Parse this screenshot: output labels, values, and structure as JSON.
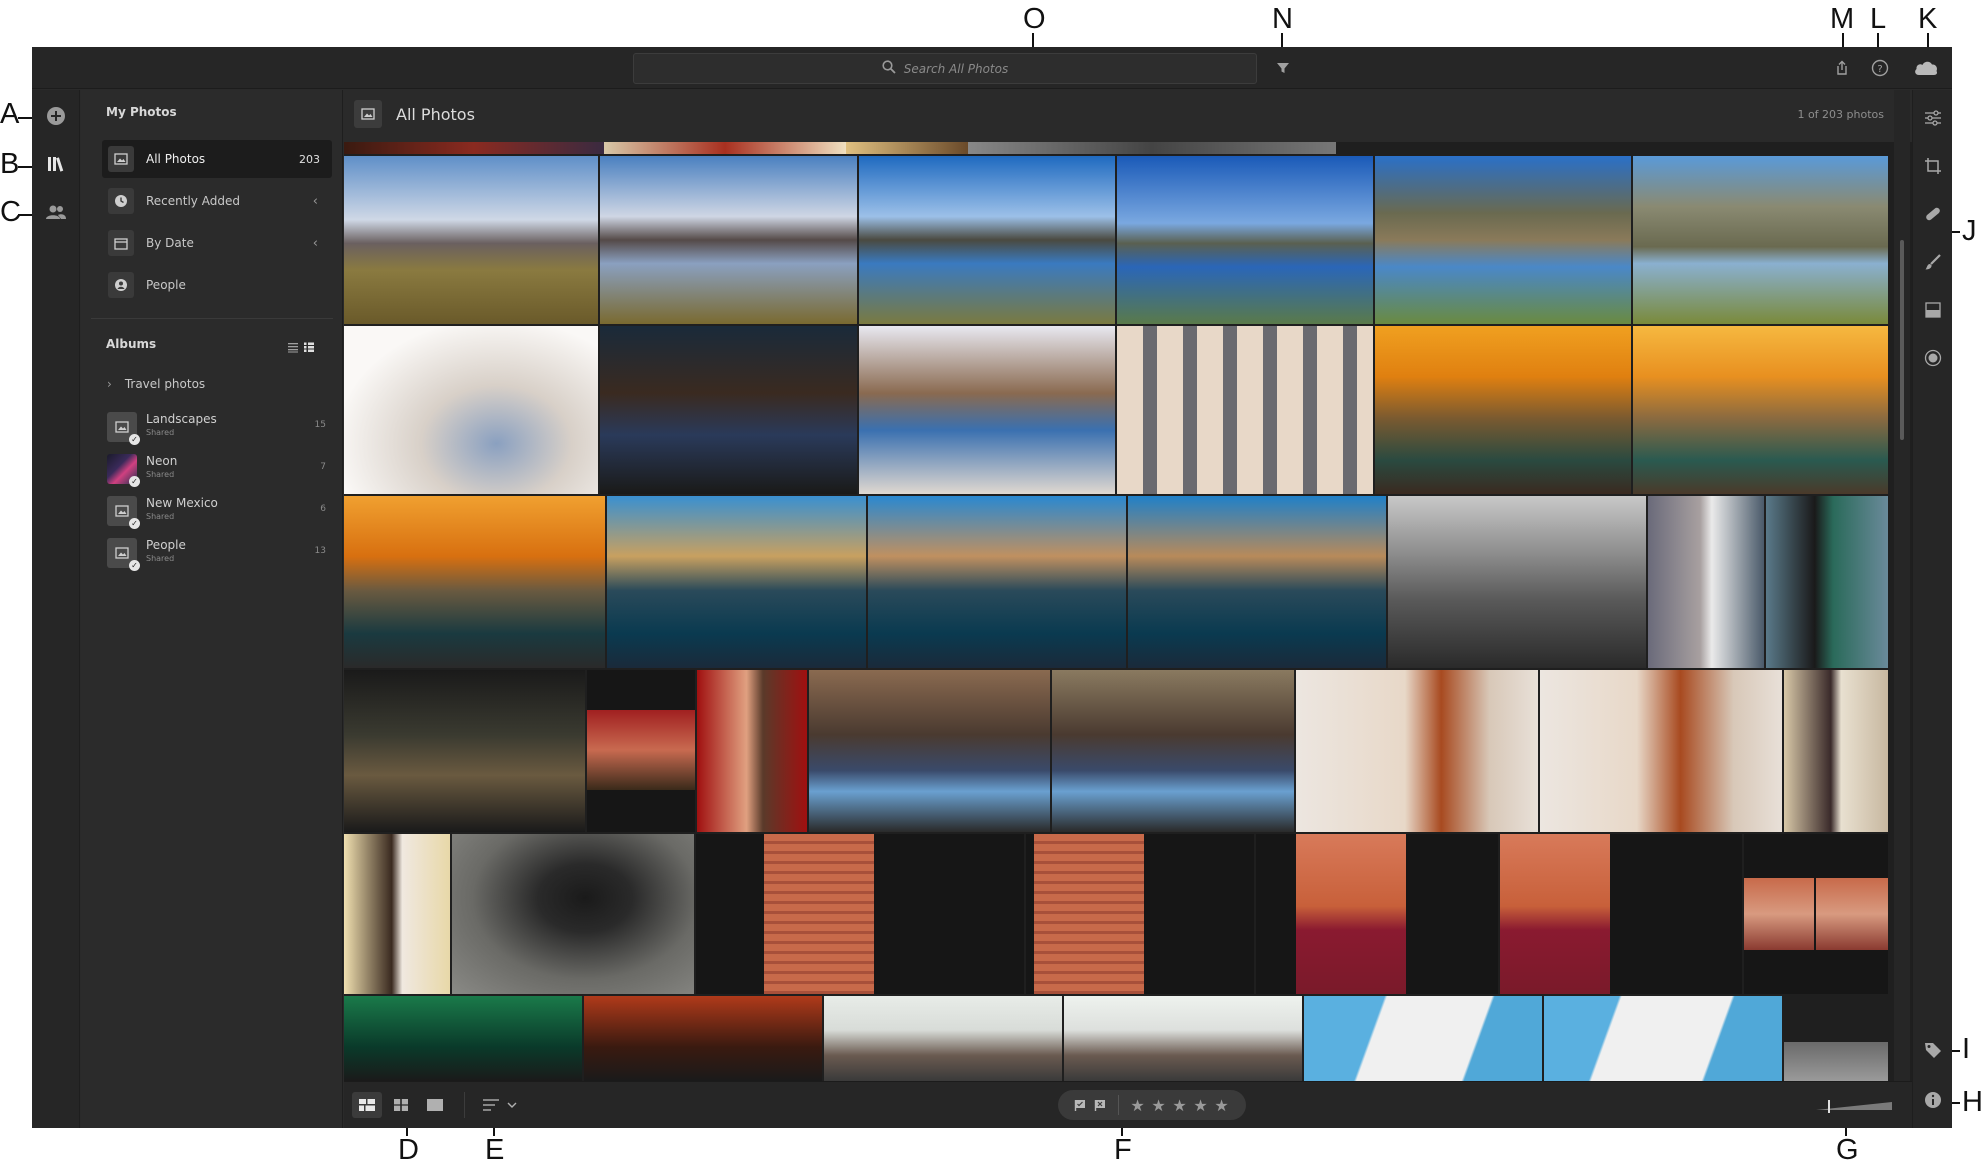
{
  "topbar": {
    "search_placeholder": "Search All Photos",
    "filter_icon": "filter-icon",
    "share_icon": "share-icon",
    "help_icon": "help-icon",
    "cloud_icon": "cloud-sync-icon"
  },
  "left_rail": {
    "add_icon": "add-photos-icon",
    "library_icon": "library-icon",
    "shared_icon": "shared-people-icon"
  },
  "sidebar": {
    "my_photos_heading": "My Photos",
    "nav": [
      {
        "label": "All Photos",
        "count": "203",
        "icon": "photo-icon"
      },
      {
        "label": "Recently Added",
        "icon": "clock-icon"
      },
      {
        "label": "By Date",
        "icon": "calendar-icon"
      },
      {
        "label": "People",
        "icon": "person-icon"
      }
    ],
    "albums_heading": "Albums",
    "folder": {
      "label": "Travel photos"
    },
    "albums": [
      {
        "name": "Landscapes",
        "sub": "Shared",
        "count": "15"
      },
      {
        "name": "Neon",
        "sub": "Shared",
        "count": "7"
      },
      {
        "name": "New Mexico",
        "sub": "Shared",
        "count": "6"
      },
      {
        "name": "People",
        "sub": "Shared",
        "count": "13"
      }
    ]
  },
  "main": {
    "title": "All Photos",
    "count_text": "1 of 203 photos"
  },
  "callouts": {
    "A": "A",
    "B": "B",
    "C": "C",
    "D": "D",
    "E": "E",
    "F": "F",
    "G": "G",
    "H": "H",
    "I": "I",
    "J": "J",
    "K": "K",
    "L": "L",
    "M": "M",
    "N": "N",
    "O": "O"
  },
  "colors": {
    "app_bg": "#2a2a2a",
    "panel_bg": "#262626",
    "selected_bg": "#1c1c1c",
    "text": "#d8d8d8"
  }
}
